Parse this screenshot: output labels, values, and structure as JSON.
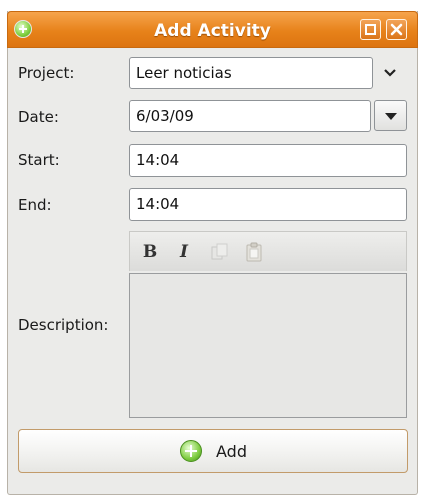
{
  "window": {
    "title": "Add Activity",
    "title_bar_color": "#e7821a"
  },
  "icons": {
    "app": "plus-circle-icon",
    "maximize": "maximize-icon",
    "close": "close-icon",
    "combo": "chevron-down-icon",
    "date_picker": "triangle-down-icon",
    "bold": "bold-icon",
    "italic": "italic-icon",
    "copy": "copy-icon",
    "paste": "paste-icon",
    "add": "plus-circle-icon"
  },
  "form": {
    "project_label": "Project:",
    "project_value": "Leer noticias",
    "date_label": "Date:",
    "date_value": "6/03/09",
    "start_label": "Start:",
    "start_value": "14:04",
    "end_label": "End:",
    "end_value": "14:04",
    "description_label": "Description:",
    "description_value": ""
  },
  "toolbar": {
    "bold_glyph": "B",
    "italic_glyph": "I"
  },
  "actions": {
    "add_label": "Add"
  }
}
